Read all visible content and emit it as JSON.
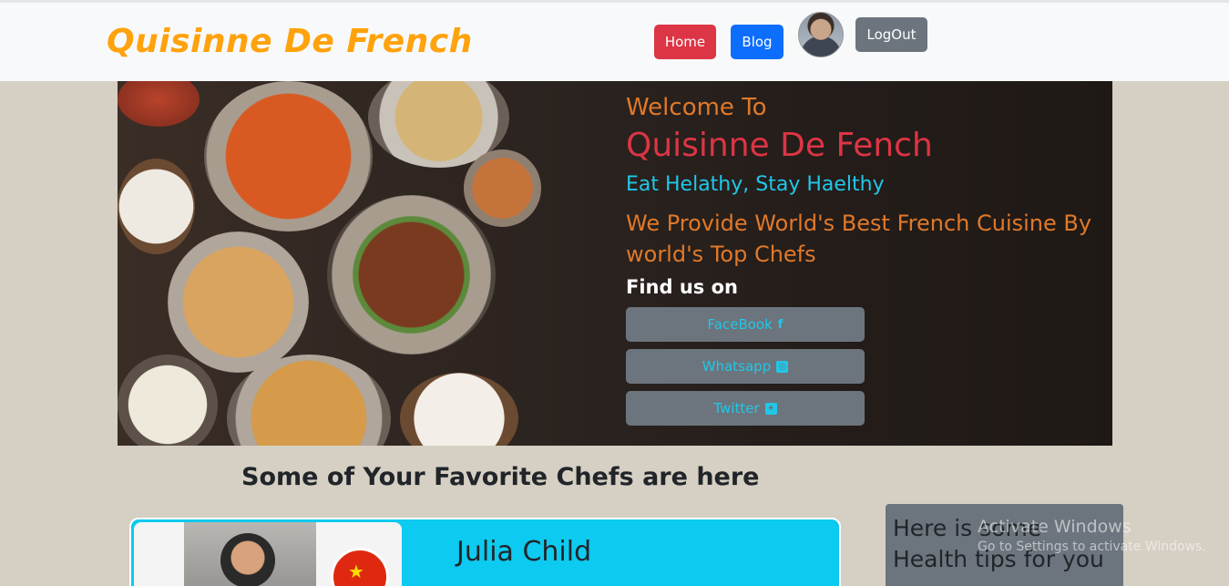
{
  "navbar": {
    "brand": "Quisinne De French",
    "home_label": "Home",
    "blog_label": "Blog",
    "logout_label": "LogOut"
  },
  "hero": {
    "welcome": "Welcome To",
    "title": "Quisinne De Fench",
    "tagline": "Eat Helathy, Stay Haelthy",
    "provide": "We Provide World's Best French Cuisine By world's Top Chefs",
    "find_us": "Find us on",
    "social": [
      {
        "label": "FaceBook",
        "icon": "facebook-icon"
      },
      {
        "label": "Whatsapp",
        "icon": "whatsapp-icon"
      },
      {
        "label": "Twitter",
        "icon": "twitter-icon"
      }
    ]
  },
  "chefs": {
    "heading": "Some of Your Favorite Chefs are here",
    "cards": [
      {
        "name": "Julia Child"
      }
    ]
  },
  "tips": {
    "title": "Here is some Health tips for you"
  },
  "watermark": {
    "line1": "Activate Windows",
    "line2": "Go to Settings to activate Windows."
  },
  "colors": {
    "brand": "#ffa20c",
    "danger": "#dc3545",
    "primary": "#0d6efd",
    "secondary": "#6c757d",
    "info": "#0dcaf0",
    "accent_orange": "#e0792a"
  }
}
